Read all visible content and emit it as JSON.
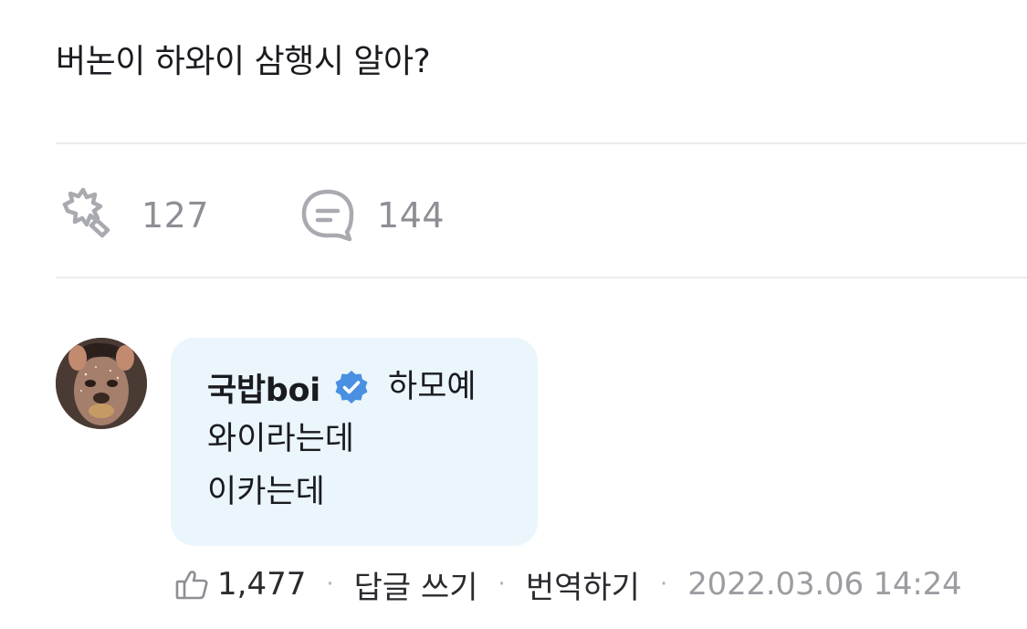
{
  "post": {
    "text": "버논이 하와이 삼행시 알아?"
  },
  "stats": {
    "likes": "127",
    "comments": "144",
    "like_icon": "smash-heart-icon",
    "comment_icon": "speech-bubble-icon"
  },
  "comment": {
    "author": "국밥boi",
    "verified_icon": "verified-badge-icon",
    "lines": [
      "하모예",
      "와이라는데",
      "이카는데"
    ],
    "bubble_color": "#eaf5fc",
    "accent": "#4a90e2"
  },
  "comment_meta": {
    "like_icon": "thumbs-up-icon",
    "like_count": "1,477",
    "separator": "·",
    "reply_label": "답글 쓰기",
    "translate_label": "번역하기",
    "timestamp": "2022.03.06 14:24"
  }
}
